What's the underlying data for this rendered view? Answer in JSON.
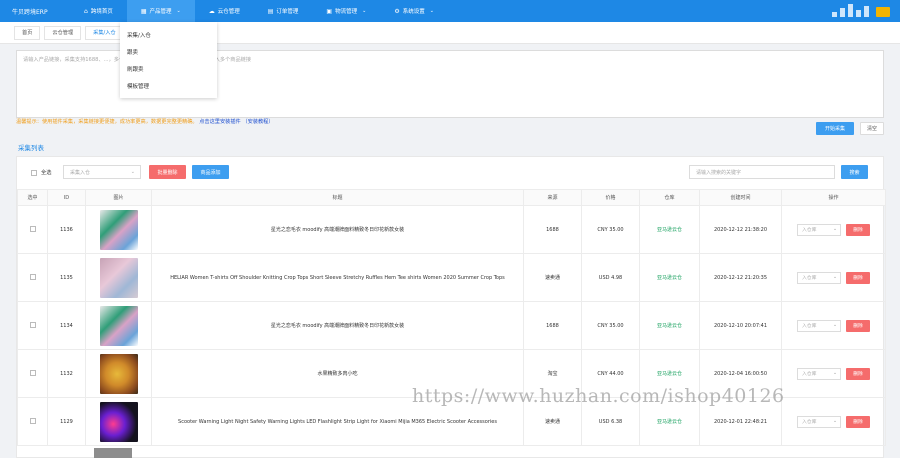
{
  "brand": "牛贝跨境ERP",
  "nav": [
    {
      "label": "跨境首页",
      "icon": "home-icon",
      "glyph": "⌂"
    },
    {
      "label": "产品管理",
      "icon": "grid-icon",
      "glyph": "▦"
    },
    {
      "label": "云仓管理",
      "icon": "cloud-icon",
      "glyph": "☁"
    },
    {
      "label": "订单管理",
      "icon": "cart-icon",
      "glyph": "▤"
    },
    {
      "label": "物流管理",
      "icon": "truck-icon",
      "glyph": "▣"
    },
    {
      "label": "系统设置",
      "icon": "gear-icon",
      "glyph": "⚙"
    }
  ],
  "dropdown": [
    "采集/入仓",
    "跟卖",
    "刷跟卖",
    "模板管理"
  ],
  "tabs": [
    "首页",
    "云仓管理",
    "采集/入仓"
  ],
  "collect": {
    "placeholder": "请输入产品链接，采集支持1688、...，多个链接请用逗号隔开，回车(Enter)换行输入多个商品链接",
    "hint_prefix": "温馨提示：使用插件采集，采集链接更便捷，成功率更高，数据更完整更精确。",
    "hint_link": "点击这里安装插件 （安装教程）",
    "start_label": "开始采集",
    "clear_label": "清空"
  },
  "list": {
    "title": "采集列表",
    "select_all": "全选",
    "status_placeholder": "采集入仓",
    "batch_delete": "批量删除",
    "add_product": "商品添加",
    "search_placeholder": "请输入搜索的关键字",
    "search_label": "搜索",
    "headers": [
      "选中",
      "ID",
      "图片",
      "标题",
      "来源",
      "价格",
      "仓库",
      "创建时间",
      "操作"
    ],
    "rows": [
      {
        "id": "1136",
        "title": "星光之恋毛衣 moodify 高端潮牌面料精致冬日印花新款女装",
        "source": "1688",
        "price": "CNY 35.00",
        "warehouse": "亚马逊云仓",
        "created": "2020-12-12 21:38:20",
        "op_select": "入仓库",
        "op_delete": "删除"
      },
      {
        "id": "1135",
        "title": "HELIAR Women T-shirts Off Shoulder Knitting Crop Tops Short Sleeve Stretchy Ruffles Hem Tee shirts Women 2020 Summer Crop Tops",
        "source": "速卖通",
        "price": "USD 4.98",
        "warehouse": "亚马逊云仓",
        "created": "2020-12-12 21:20:35",
        "op_select": "入仓库",
        "op_delete": "删除"
      },
      {
        "id": "1134",
        "title": "星光之恋毛衣 moodify 高端潮牌面料精致冬日印花新款女装",
        "source": "1688",
        "price": "CNY 35.00",
        "warehouse": "亚马逊云仓",
        "created": "2020-12-10 20:07:41",
        "op_select": "入仓库",
        "op_delete": "删除"
      },
      {
        "id": "1132",
        "title": "水果精致多肉小吃",
        "source": "淘宝",
        "price": "CNY 44.00",
        "warehouse": "亚马逊云仓",
        "created": "2020-12-04 16:00:50",
        "op_select": "入仓库",
        "op_delete": "删除"
      },
      {
        "id": "1129",
        "title": "Scooter Warning Light Night Safety Warning Lights LED Flashlight Strip Light for Xiaomi Mijia M365 Electric Scooter Accessories",
        "source": "速卖通",
        "price": "USD 6.38",
        "warehouse": "亚马逊云仓",
        "created": "2020-12-01 22:48:21",
        "op_select": "入仓库",
        "op_delete": "删除"
      }
    ]
  },
  "watermark": "https://www.huzhan.com/ishop40126"
}
